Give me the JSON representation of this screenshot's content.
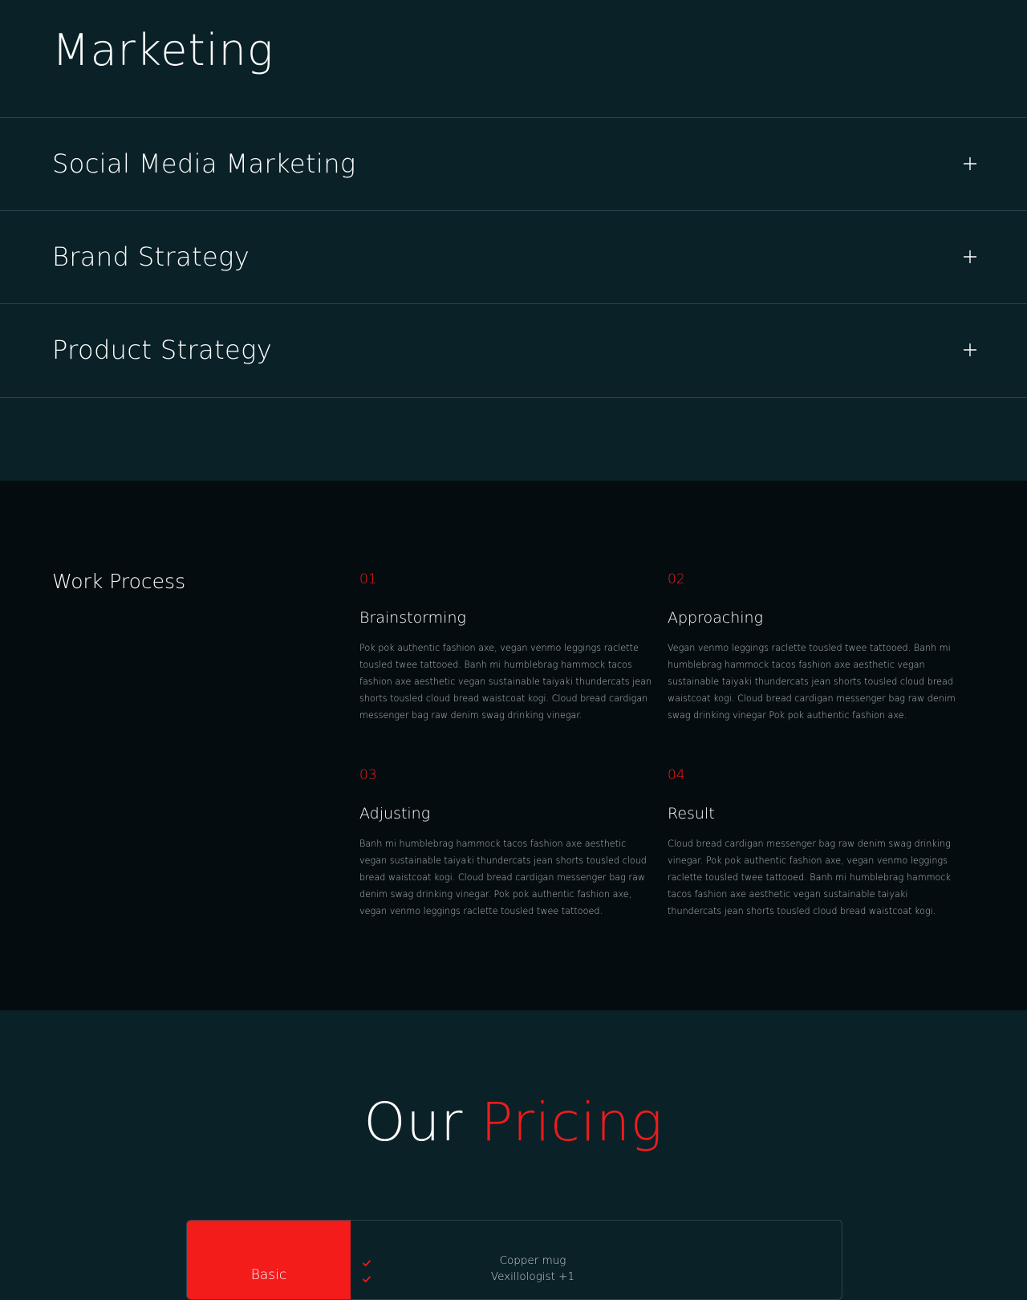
{
  "marketing": {
    "title": "Marketing",
    "items": [
      {
        "label": "Social Media Marketing"
      },
      {
        "label": "Brand Strategy"
      },
      {
        "label": "Product Strategy"
      }
    ]
  },
  "process": {
    "heading": "Work Process",
    "steps": [
      {
        "number": "01",
        "title": "Brainstorming",
        "text": "Pok pok authentic fashion axe, vegan venmo leggings raclette tousled twee tattooed. Banh mi humblebrag hammock tacos fashion axe aesthetic vegan sustainable taiyaki thundercats jean shorts tousled cloud bread waistcoat kogi. Cloud bread cardigan messenger bag raw denim swag drinking vinegar."
      },
      {
        "number": "02",
        "title": "Approaching",
        "text": "Vegan venmo leggings raclette tousled twee tattooed. Banh mi humblebrag hammock tacos fashion axe aesthetic vegan sustainable taiyaki thundercats jean shorts tousled cloud bread waistcoat kogi. Cloud bread cardigan messenger bag raw denim swag drinking vinegar Pok pok authentic fashion axe."
      },
      {
        "number": "03",
        "title": "Adjusting",
        "text": "Banh mi humblebrag hammock tacos fashion axe aesthetic vegan sustainable taiyaki thundercats jean shorts tousled cloud bread waistcoat kogi. Cloud bread cardigan messenger bag raw denim swag drinking vinegar. Pok pok authentic fashion axe, vegan venmo leggings raclette tousled twee tattooed."
      },
      {
        "number": "04",
        "title": "Result",
        "text": "Cloud bread cardigan messenger bag raw denim swag drinking vinegar. Pok pok authentic fashion axe, vegan venmo leggings raclette tousled twee tattooed. Banh mi humblebrag hammock tacos fashion axe aesthetic vegan sustainable taiyaki thundercats jean shorts tousled cloud bread waistcoat kogi."
      }
    ]
  },
  "pricing": {
    "title_prefix": "Our",
    "title_accent": "Pricing",
    "plans": [
      {
        "name": "Basic",
        "features": [
          "Copper mug",
          "Vexillologist +1"
        ]
      }
    ]
  },
  "colors": {
    "accent": "#f01b1b",
    "background": "#0b2128",
    "process_background": "#050c10",
    "divider": "#2a4550"
  },
  "icons": {
    "accordion": "plus-icon",
    "feature": "check-icon"
  }
}
